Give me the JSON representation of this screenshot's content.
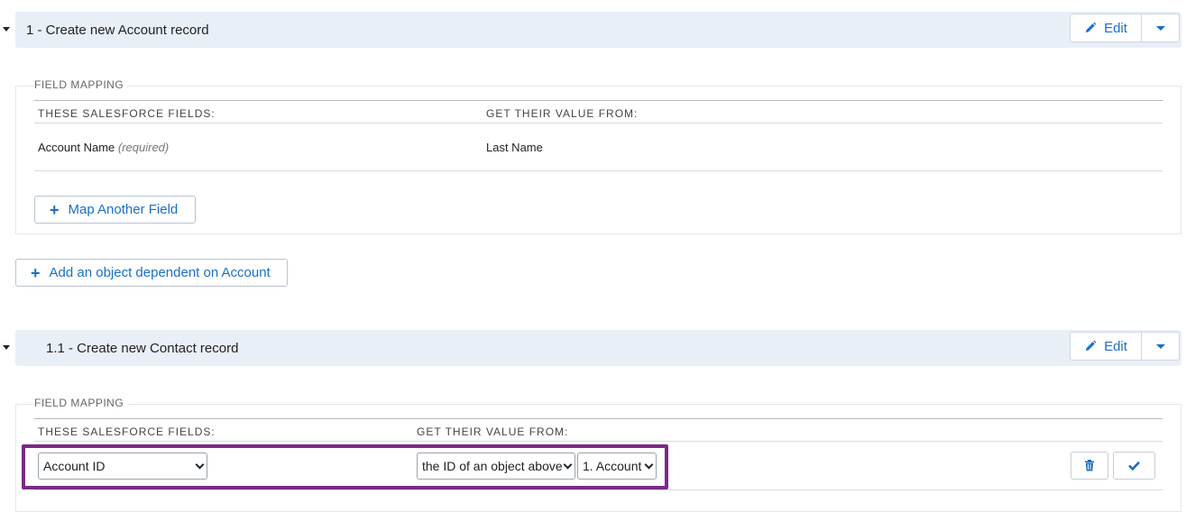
{
  "sections": [
    {
      "title": "1 - Create new Account record",
      "edit_label": "Edit",
      "legend": "FIELD MAPPING",
      "col_fields": "THESE SALESFORCE FIELDS:",
      "col_value": "GET THEIR VALUE FROM:",
      "rows": [
        {
          "field": "Account Name",
          "required": "(required)",
          "value": "Last Name"
        }
      ],
      "map_another": "Map Another Field",
      "add_dependent": "Add an object dependent on Account"
    },
    {
      "title": "1.1 - Create new Contact record",
      "edit_label": "Edit",
      "legend": "FIELD MAPPING",
      "col_fields": "THESE SALESFORCE FIELDS:",
      "col_value": "GET THEIR VALUE FROM:",
      "edit_row": {
        "field_select": "Account ID",
        "source_select": "the ID of an object above",
        "object_select": "1. Account"
      }
    }
  ],
  "colors": {
    "accent": "#1a6fc4",
    "header_bg": "#e9eff7",
    "highlight": "#7b2a86"
  }
}
